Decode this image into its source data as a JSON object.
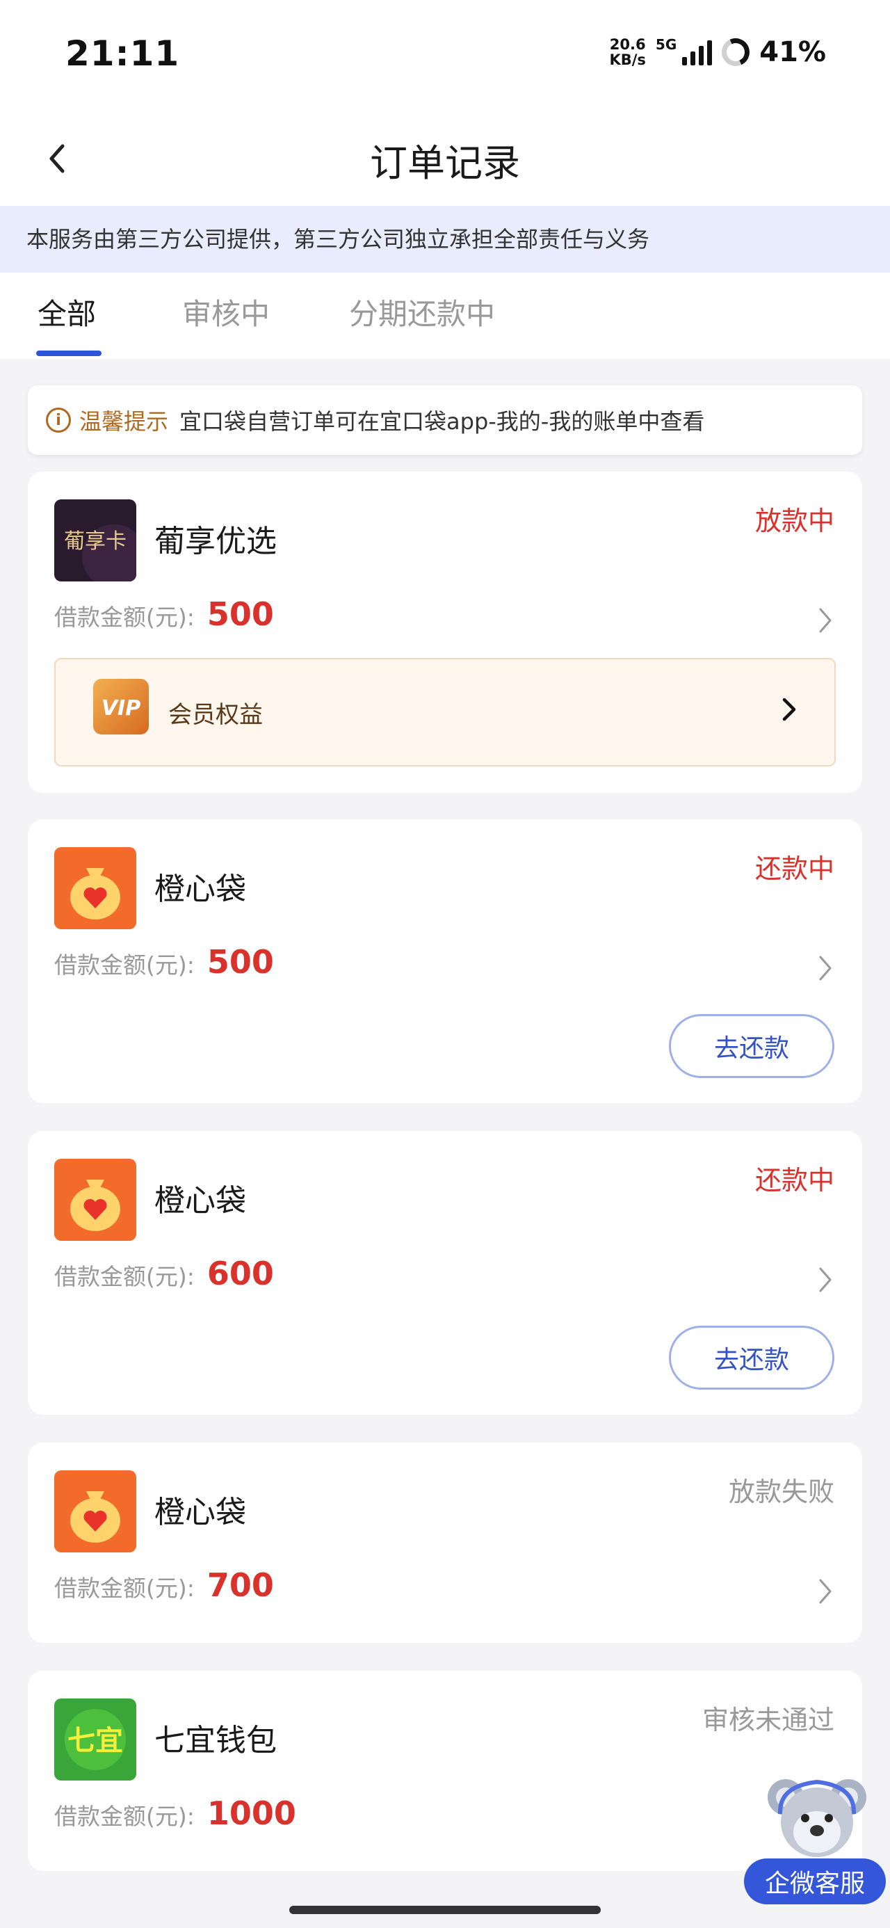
{
  "status_bar": {
    "time": "21:11",
    "net_speed_value": "20.6",
    "net_speed_unit": "KB/s",
    "network": "5G",
    "battery": "41%"
  },
  "nav": {
    "title": "订单记录",
    "back_icon": "chevron-left-icon"
  },
  "notice": "本服务由第三方公司提供，第三方公司独立承担全部责任与义务",
  "tabs": [
    {
      "label": "全部",
      "active": true
    },
    {
      "label": "审核中",
      "active": false
    },
    {
      "label": "分期还款中",
      "active": false
    }
  ],
  "tip": {
    "label": "温馨提示",
    "text": "宜口袋自营订单可在宜口袋app-我的-我的账单中查看"
  },
  "amount_label": "借款金额(元):",
  "orders": [
    {
      "name": "葡享优选",
      "icon_text": "葡享卡",
      "status": "放款中",
      "amount": "500",
      "vip_label": "会员权益",
      "vip_badge": "VIP"
    },
    {
      "name": "橙心袋",
      "status": "还款中",
      "amount": "500",
      "button": "去还款"
    },
    {
      "name": "橙心袋",
      "status": "还款中",
      "amount": "600",
      "button": "去还款"
    },
    {
      "name": "橙心袋",
      "status": "放款失败",
      "amount": "700"
    },
    {
      "name": "七宜钱包",
      "icon_text": "七宜",
      "status": "审核未通过",
      "amount": "1000"
    }
  ],
  "customer_service": "企微客服",
  "colors": {
    "accent": "#2d55d9",
    "status_red": "#d9322c",
    "notice_bg": "#e9ecfc",
    "tip_label": "#b06820"
  }
}
